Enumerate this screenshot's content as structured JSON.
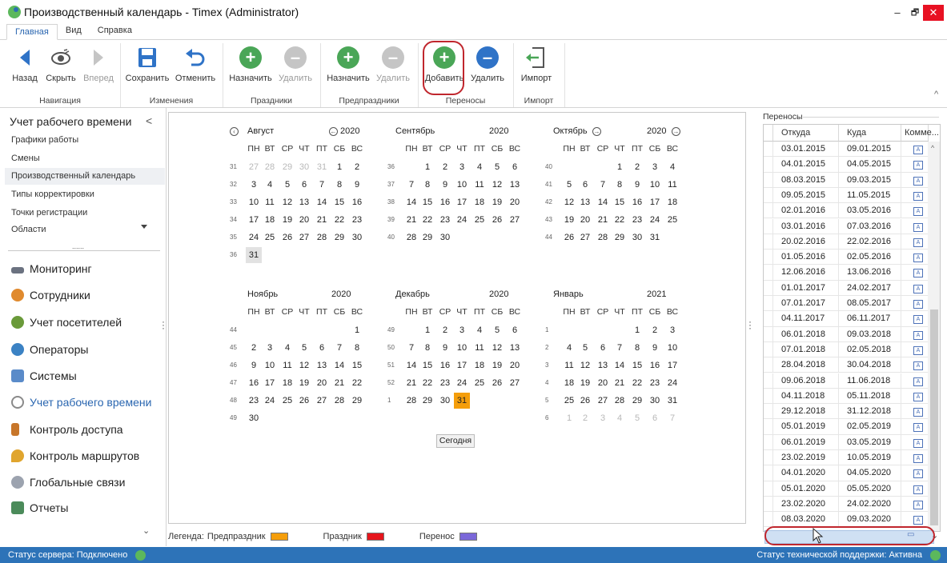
{
  "window": {
    "title": "Производственный календарь - Timex (Administrator)",
    "minimize": "–",
    "restore": "🗗",
    "close": "✕"
  },
  "tabs": [
    "Главная",
    "Вид",
    "Справка"
  ],
  "ribbon": {
    "buttons": [
      {
        "label": "Назад",
        "icon": "arrow-left-icon",
        "disabled": false
      },
      {
        "label": "Скрыть",
        "icon": "eye-icon",
        "disabled": false
      },
      {
        "label": "Вперед",
        "icon": "arrow-right-icon",
        "disabled": true
      },
      {
        "label": "Сохранить",
        "icon": "save-icon",
        "disabled": false
      },
      {
        "label": "Отменить",
        "icon": "undo-icon",
        "disabled": false
      },
      {
        "label": "Назначить",
        "icon": "plus-icon",
        "disabled": false
      },
      {
        "label": "Удалить",
        "icon": "minus-icon",
        "disabled": true
      },
      {
        "label": "Назначить",
        "icon": "plus-icon",
        "disabled": false
      },
      {
        "label": "Удалить",
        "icon": "minus-icon",
        "disabled": true
      },
      {
        "label": "Добавить",
        "icon": "plus-icon",
        "disabled": false
      },
      {
        "label": "Удалить",
        "icon": "minus-icon",
        "disabled": false
      },
      {
        "label": "Импорт",
        "icon": "import-icon",
        "disabled": false
      }
    ],
    "groups": [
      "Навигация",
      "Изменения",
      "Праздники",
      "Предпраздники",
      "Переносы",
      "Импорт"
    ],
    "collapse": "^"
  },
  "sidebar": {
    "header": "Учет рабочего времени",
    "collapse": "<",
    "items": [
      "Графики работы",
      "Смены",
      "Производственный календарь",
      "Типы корректировки",
      "Точки регистрации",
      "Области",
      "......"
    ],
    "sections": [
      "Мониторинг",
      "Сотрудники",
      "Учет посетителей",
      "Операторы",
      "Системы",
      "Учет рабочего времени",
      "Контроль доступа",
      "Контроль маршрутов",
      "Глобальные связи",
      "Отчеты"
    ],
    "more": "⌄"
  },
  "calendar": {
    "weekdays": [
      "ПН",
      "ВТ",
      "СР",
      "ЧТ",
      "ПТ",
      "СБ",
      "ВС"
    ],
    "months": [
      {
        "name": "Август",
        "year": "2020",
        "prev_nav": "‹",
        "year_nav": "←",
        "first": 5,
        "days": 31,
        "weeks": [
          "31",
          "32",
          "33",
          "34",
          "35",
          "36"
        ],
        "lead": [
          "27",
          "28",
          "29",
          "30",
          "31"
        ],
        "trail": [],
        "selected": 31,
        "holiday": null
      },
      {
        "name": "Сентябрь",
        "year": "2020",
        "first": 1,
        "days": 30,
        "weeks": [
          "36",
          "37",
          "38",
          "39",
          "40"
        ],
        "lead": [],
        "trail": [],
        "selected": null,
        "holiday": null
      },
      {
        "name": "Октябрь",
        "year": "2020",
        "name_nav": "→",
        "year_nav": "→",
        "first": 3,
        "days": 31,
        "weeks": [
          "40",
          "41",
          "42",
          "43",
          "44"
        ],
        "lead": [],
        "trail": [],
        "selected": null,
        "holiday": null
      },
      {
        "name": "Ноябрь",
        "year": "2020",
        "first": 6,
        "days": 30,
        "weeks": [
          "44",
          "45",
          "46",
          "47",
          "48",
          "49"
        ],
        "lead": [],
        "trail": [],
        "selected": null,
        "holiday": null
      },
      {
        "name": "Декабрь",
        "year": "2020",
        "first": 1,
        "days": 31,
        "weeks": [
          "49",
          "50",
          "51",
          "52",
          "1"
        ],
        "lead": [],
        "trail": [],
        "selected": null,
        "holiday": 31
      },
      {
        "name": "Январь",
        "year": "2021",
        "first": 4,
        "days": 31,
        "weeks": [
          "1",
          "2",
          "3",
          "4",
          "5",
          "6"
        ],
        "lead": [],
        "trail": [
          "1",
          "2",
          "3",
          "4",
          "5",
          "6",
          "7"
        ],
        "selected": null,
        "holiday": null
      }
    ],
    "today_label": "Сегодня"
  },
  "legend": {
    "label": "Легенда:",
    "items": [
      {
        "label": "Предпраздник",
        "color": "#f59e0b"
      },
      {
        "label": "Праздник",
        "color": "#e5151c"
      },
      {
        "label": "Перенос",
        "color": "#7b68d9"
      }
    ]
  },
  "transfers": {
    "title": "Переносы",
    "columns": [
      "Откуда",
      "Куда",
      "Комме..."
    ],
    "rows": [
      [
        "03.01.2015",
        "09.01.2015"
      ],
      [
        "04.01.2015",
        "04.05.2015"
      ],
      [
        "08.03.2015",
        "09.03.2015"
      ],
      [
        "09.05.2015",
        "11.05.2015"
      ],
      [
        "02.01.2016",
        "03.05.2016"
      ],
      [
        "03.01.2016",
        "07.03.2016"
      ],
      [
        "20.02.2016",
        "22.02.2016"
      ],
      [
        "01.05.2016",
        "02.05.2016"
      ],
      [
        "12.06.2016",
        "13.06.2016"
      ],
      [
        "01.01.2017",
        "24.02.2017"
      ],
      [
        "07.01.2017",
        "08.05.2017"
      ],
      [
        "04.11.2017",
        "06.11.2017"
      ],
      [
        "06.01.2018",
        "09.03.2018"
      ],
      [
        "07.01.2018",
        "02.05.2018"
      ],
      [
        "28.04.2018",
        "30.04.2018"
      ],
      [
        "09.06.2018",
        "11.06.2018"
      ],
      [
        "04.11.2018",
        "05.11.2018"
      ],
      [
        "29.12.2018",
        "31.12.2018"
      ],
      [
        "05.01.2019",
        "02.05.2019"
      ],
      [
        "06.01.2019",
        "03.05.2019"
      ],
      [
        "23.02.2019",
        "10.05.2019"
      ],
      [
        "04.01.2020",
        "04.05.2020"
      ],
      [
        "05.01.2020",
        "05.05.2020"
      ],
      [
        "23.02.2020",
        "24.02.2020"
      ],
      [
        "08.03.2020",
        "09.03.2020"
      ]
    ],
    "comment_glyph": "A"
  },
  "status": {
    "server": "Статус сервера: Подключено",
    "support": "Статус технической поддержки: Активна"
  },
  "colors": {
    "accent": "#2a66b0",
    "green": "#4aa657",
    "disabled": "#c5c5c5",
    "blue": "#2f73c7",
    "status_bar": "#2d73b8",
    "highlight_ring": "#c0262d"
  }
}
